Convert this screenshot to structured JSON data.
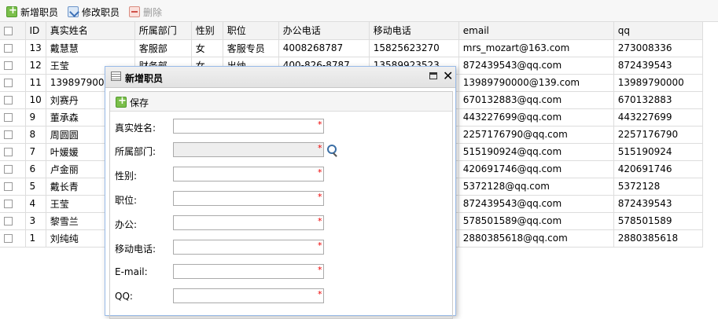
{
  "toolbar": {
    "add_label": "新增职员",
    "edit_label": "修改职员",
    "delete_label": "删除"
  },
  "grid": {
    "columns": [
      "ID",
      "真实姓名",
      "所属部门",
      "性别",
      "职位",
      "办公电话",
      "移动电话",
      "email",
      "qq"
    ],
    "rows": [
      [
        "13",
        "戴慧慧",
        "客服部",
        "女",
        "客服专员",
        "4008268787",
        "15825623270",
        "mrs_mozart@163.com",
        "273008336"
      ],
      [
        "12",
        "王莹",
        "财务部",
        "女",
        "出纳",
        "400-826-8787",
        "13589923523",
        "872439543@qq.com",
        "872439543"
      ],
      [
        "11",
        "13989790000",
        "",
        "",
        "",
        "",
        "",
        "13989790000@139.com",
        "13989790000"
      ],
      [
        "10",
        "刘赛丹",
        "",
        "",
        "",
        "",
        "",
        "670132883@qq.com",
        "670132883"
      ],
      [
        "9",
        "董承森",
        "",
        "",
        "",
        "",
        "",
        "443227699@qq.com",
        "443227699"
      ],
      [
        "8",
        "周圆圆",
        "",
        "",
        "",
        "",
        "",
        "2257176790@qq.com",
        "2257176790"
      ],
      [
        "7",
        "叶媛媛",
        "",
        "",
        "",
        "",
        "",
        "515190924@qq.com",
        "515190924"
      ],
      [
        "6",
        "卢金丽",
        "",
        "",
        "",
        "",
        "",
        "420691746@qq.com",
        "420691746"
      ],
      [
        "5",
        "戴长青",
        "",
        "",
        "",
        "",
        "",
        "5372128@qq.com",
        "5372128"
      ],
      [
        "4",
        "王莹",
        "",
        "",
        "",
        "",
        "",
        "872439543@qq.com",
        "872439543"
      ],
      [
        "3",
        "黎雪兰",
        "",
        "",
        "",
        "",
        "",
        "578501589@qq.com",
        "578501589"
      ],
      [
        "1",
        "刘纯纯",
        "",
        "",
        "",
        "",
        "",
        "2880385618@qq.com",
        "2880385618"
      ]
    ]
  },
  "dialog": {
    "title": "新增职员",
    "save_label": "保存",
    "required_mark": "*",
    "fields": [
      {
        "label": "真实姓名:",
        "value": ""
      },
      {
        "label": "所属部门:",
        "value": ""
      },
      {
        "label": "性别:",
        "value": ""
      },
      {
        "label": "职位:",
        "value": ""
      },
      {
        "label": "办公:",
        "value": ""
      },
      {
        "label": "移动电话:",
        "value": ""
      },
      {
        "label": "E-mail:",
        "value": ""
      },
      {
        "label": "QQ:",
        "value": ""
      }
    ]
  },
  "icons": {
    "add": "add-icon",
    "edit": "edit-icon",
    "delete": "delete-icon",
    "save": "save-icon",
    "dialog": "window-icon",
    "maximize": "maximize-icon",
    "close": "close-icon",
    "lookup": "search-icon"
  },
  "colors": {
    "header_bg": "#f3f3f3",
    "grid_line": "#dddddd",
    "dialog_border": "#99bbe8",
    "required": "#ee0000"
  }
}
